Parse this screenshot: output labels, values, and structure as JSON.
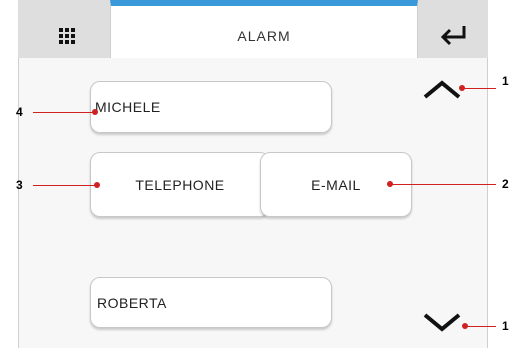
{
  "header": {
    "title": "ALARM",
    "accent_color": "#3a9ad9",
    "menu_icon": "grid-icon",
    "back_icon": "return-arrow-icon"
  },
  "contacts": {
    "michele": "MICHELE",
    "telephone": "TELEPHONE",
    "email": "E-MAIL",
    "roberta": "ROBERTA"
  },
  "scroll": {
    "up_icon": "chevron-up-icon",
    "down_icon": "chevron-down-icon"
  },
  "callouts": {
    "up": "1",
    "email": "2",
    "telephone": "3",
    "michele": "4",
    "down": "1",
    "color": "#d02020"
  }
}
